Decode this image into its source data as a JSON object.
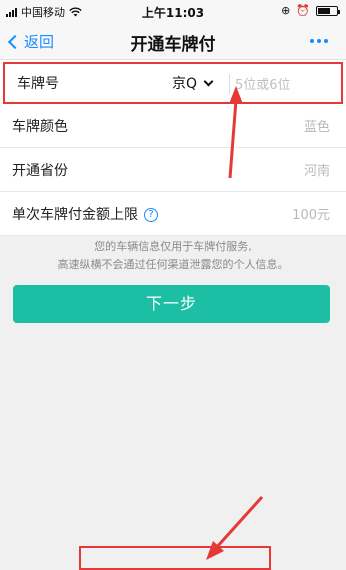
{
  "status_bar": {
    "carrier": "中国移动",
    "time": "上午11:03",
    "wifi_icon": "wifi-icon",
    "battery_level": 0.6
  },
  "nav": {
    "back_label": "返回",
    "title": "开通车牌付",
    "more_icon": "more-icon"
  },
  "form": {
    "plate": {
      "label": "车牌号",
      "prefix": "京Q",
      "placeholder": "5位或6位"
    },
    "color": {
      "label": "车牌颜色",
      "value": "蓝色"
    },
    "province": {
      "label": "开通省份",
      "value": "河南"
    },
    "limit": {
      "label": "单次车牌付金额上限",
      "value": "100元",
      "help_icon": "?"
    }
  },
  "notice": {
    "line1": "您的车辆信息仅用于车牌付服务,",
    "line2": "高速纵横不会通过任何渠道泄露您的个人信息。"
  },
  "next_button_label": "下一步",
  "colors": {
    "accent": "#1a8cff",
    "primary_button": "#1cbfa4",
    "highlight": "#e53935"
  }
}
